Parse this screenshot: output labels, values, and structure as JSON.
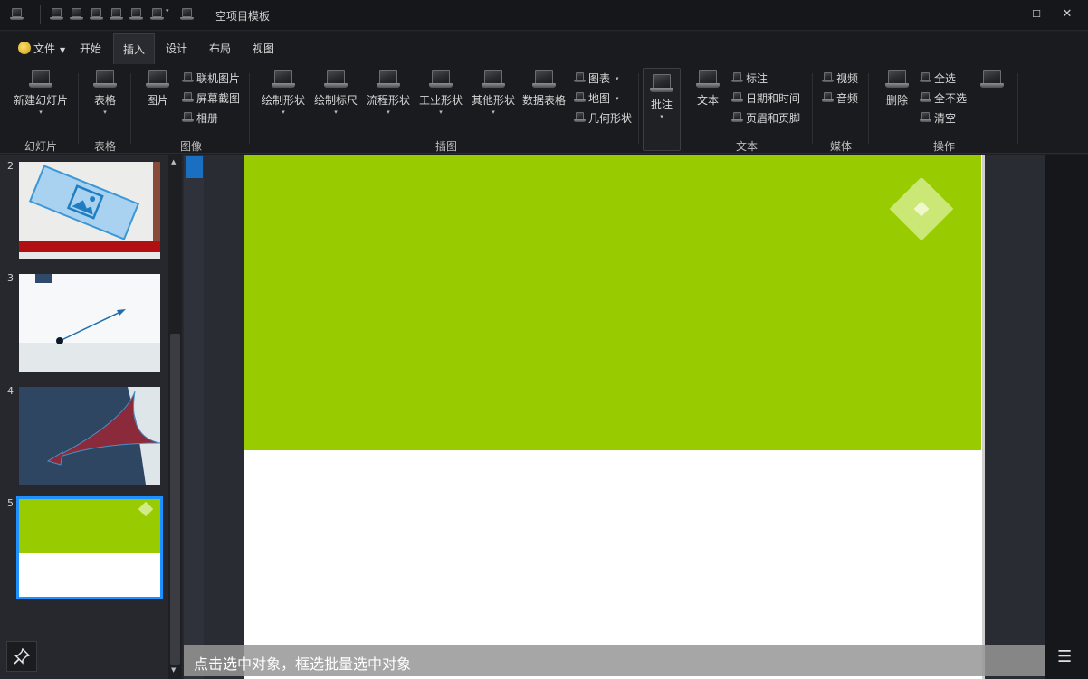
{
  "window": {
    "title": "空项目模板",
    "controls": {
      "minimize": "–",
      "maximize": "☐",
      "close": "✕"
    }
  },
  "menu": {
    "file": "文件",
    "tabs": [
      "开始",
      "插入",
      "设计",
      "布局",
      "视图"
    ],
    "active_tab": "插入"
  },
  "ribbon": {
    "slides": {
      "new_slide": "新建幻灯片",
      "group": "幻灯片"
    },
    "table": {
      "table": "表格",
      "group": "表格"
    },
    "image": {
      "picture": "图片",
      "online_picture": "联机图片",
      "screenshot": "屏幕截图",
      "album": "相册",
      "group": "图像"
    },
    "illustration": {
      "draw_shape": "绘制形状",
      "draw_ruler": "绘制标尺",
      "flow_shape": "流程形状",
      "industry_shape": "工业形状",
      "other_shape": "其他形状",
      "data_table": "数据表格",
      "chart": "图表",
      "map": "地图",
      "geometry": "几何形状",
      "group": "插图"
    },
    "annotation": {
      "label": "批注"
    },
    "text": {
      "text": "文本",
      "callout": "标注",
      "datetime": "日期和时间",
      "header_footer": "页眉和页脚",
      "group": "文本"
    },
    "media": {
      "video": "视频",
      "audio": "音频",
      "group": "媒体"
    },
    "operation": {
      "delete": "删除",
      "select_all": "全选",
      "deselect_all": "全不选",
      "clear": "清空",
      "group": "操作"
    }
  },
  "thumbnails": {
    "numbers": [
      "2",
      "3",
      "4",
      "5"
    ],
    "selected": "5"
  },
  "status": {
    "hint": "点击选中对象，框选批量选中对象"
  },
  "colors": {
    "slide_green": "#99cc00",
    "selection_blue": "#1e90ff"
  }
}
